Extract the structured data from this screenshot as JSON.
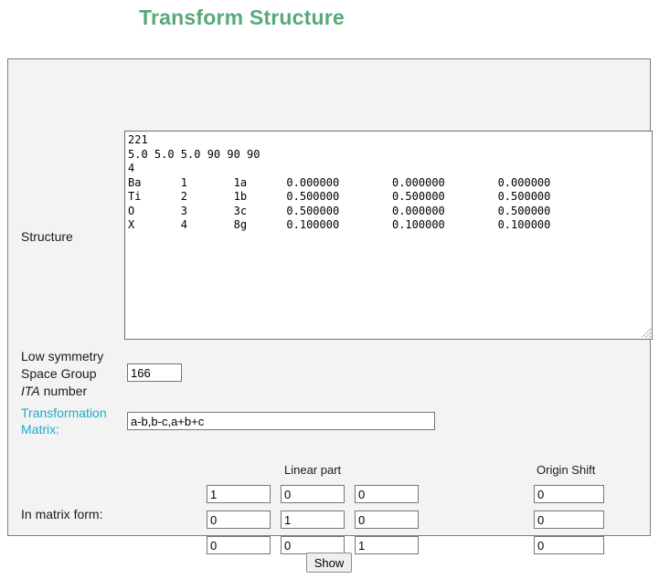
{
  "page": {
    "title": "Transform Structure"
  },
  "form": {
    "structure": {
      "label": "Structure",
      "value": "221\n5.0 5.0 5.0 90 90 90\n4\nBa      1       1a      0.000000        0.000000        0.000000\nTi      2       1b      0.500000        0.500000        0.500000\nO       3       3c      0.500000        0.000000        0.500000\nX       4       8g      0.100000        0.100000        0.100000",
      "placeholder": ""
    },
    "space_group": {
      "label_line1": "Low symmetry",
      "label_line2": "Space Group",
      "label_ita": "ITA",
      "label_line3_rest": " number",
      "value": "166",
      "placeholder": ""
    },
    "transformation_matrix": {
      "label_line1": "Transformation",
      "label_line2": "Matrix:",
      "value": "a-b,b-c,a+b+c",
      "placeholder": "",
      "color": "#1aaccd"
    },
    "matrix_form": {
      "label": "In matrix form:",
      "linear_part_header": "Linear part",
      "origin_shift_header": "Origin Shift",
      "linear": [
        [
          "1",
          "0",
          "0"
        ],
        [
          "0",
          "1",
          "0"
        ],
        [
          "0",
          "0",
          "1"
        ]
      ],
      "origin_shift": [
        "0",
        "0",
        "0"
      ]
    },
    "submit": {
      "label": "Show"
    }
  },
  "colors": {
    "title": "#57a87b",
    "accent": "#1aaccd",
    "panel_bg": "#f3f3f3",
    "panel_border": "#7d7d7d"
  }
}
